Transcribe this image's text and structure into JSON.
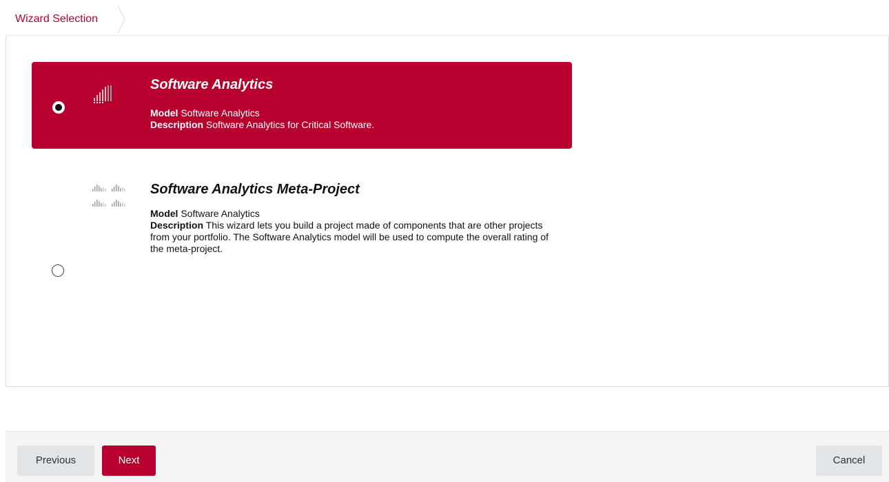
{
  "breadcrumb": {
    "current": "Wizard Selection"
  },
  "wizards": [
    {
      "title": "Software Analytics",
      "model_label": "Model",
      "model_value": "Software Analytics",
      "description_label": "Description",
      "description_value": "Software Analytics for Critical Software.",
      "selected": true,
      "icon": "bar-chart-icon"
    },
    {
      "title": "Software Analytics Meta-Project",
      "model_label": "Model",
      "model_value": "Software Analytics",
      "description_label": "Description",
      "description_value": "This wizard lets you build a project made of components that are other projects from your portfolio. The Software Analytics model will be used to compute the overall rating of the meta-project.",
      "selected": false,
      "icon": "multi-bar-chart-icon"
    }
  ],
  "footer": {
    "previous_label": "Previous",
    "next_label": "Next",
    "cancel_label": "Cancel"
  },
  "colors": {
    "accent": "#b8002e",
    "button_neutral": "#e2e5e8",
    "footer_bg": "#f5f5f5"
  }
}
